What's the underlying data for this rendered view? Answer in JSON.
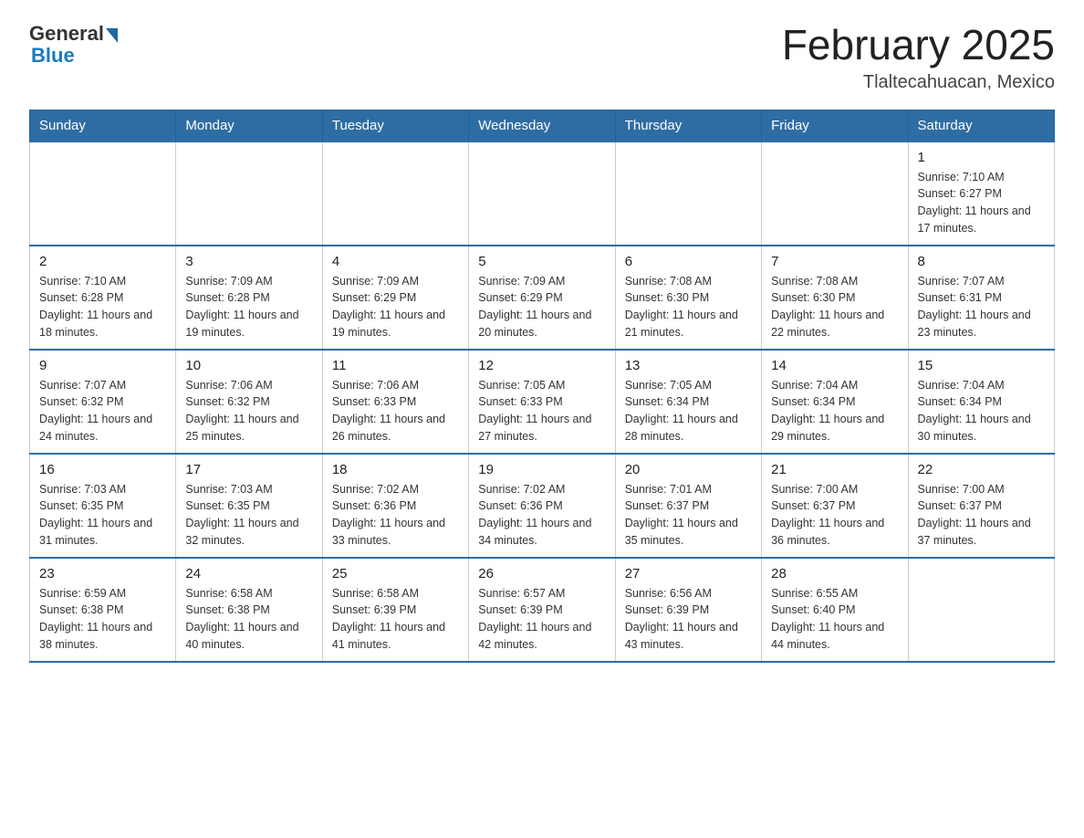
{
  "logo": {
    "general": "General",
    "blue": "Blue"
  },
  "header": {
    "title": "February 2025",
    "location": "Tlaltecahuacan, Mexico"
  },
  "weekdays": [
    "Sunday",
    "Monday",
    "Tuesday",
    "Wednesday",
    "Thursday",
    "Friday",
    "Saturday"
  ],
  "weeks": [
    [
      {
        "day": "",
        "info": ""
      },
      {
        "day": "",
        "info": ""
      },
      {
        "day": "",
        "info": ""
      },
      {
        "day": "",
        "info": ""
      },
      {
        "day": "",
        "info": ""
      },
      {
        "day": "",
        "info": ""
      },
      {
        "day": "1",
        "info": "Sunrise: 7:10 AM\nSunset: 6:27 PM\nDaylight: 11 hours and 17 minutes."
      }
    ],
    [
      {
        "day": "2",
        "info": "Sunrise: 7:10 AM\nSunset: 6:28 PM\nDaylight: 11 hours and 18 minutes."
      },
      {
        "day": "3",
        "info": "Sunrise: 7:09 AM\nSunset: 6:28 PM\nDaylight: 11 hours and 19 minutes."
      },
      {
        "day": "4",
        "info": "Sunrise: 7:09 AM\nSunset: 6:29 PM\nDaylight: 11 hours and 19 minutes."
      },
      {
        "day": "5",
        "info": "Sunrise: 7:09 AM\nSunset: 6:29 PM\nDaylight: 11 hours and 20 minutes."
      },
      {
        "day": "6",
        "info": "Sunrise: 7:08 AM\nSunset: 6:30 PM\nDaylight: 11 hours and 21 minutes."
      },
      {
        "day": "7",
        "info": "Sunrise: 7:08 AM\nSunset: 6:30 PM\nDaylight: 11 hours and 22 minutes."
      },
      {
        "day": "8",
        "info": "Sunrise: 7:07 AM\nSunset: 6:31 PM\nDaylight: 11 hours and 23 minutes."
      }
    ],
    [
      {
        "day": "9",
        "info": "Sunrise: 7:07 AM\nSunset: 6:32 PM\nDaylight: 11 hours and 24 minutes."
      },
      {
        "day": "10",
        "info": "Sunrise: 7:06 AM\nSunset: 6:32 PM\nDaylight: 11 hours and 25 minutes."
      },
      {
        "day": "11",
        "info": "Sunrise: 7:06 AM\nSunset: 6:33 PM\nDaylight: 11 hours and 26 minutes."
      },
      {
        "day": "12",
        "info": "Sunrise: 7:05 AM\nSunset: 6:33 PM\nDaylight: 11 hours and 27 minutes."
      },
      {
        "day": "13",
        "info": "Sunrise: 7:05 AM\nSunset: 6:34 PM\nDaylight: 11 hours and 28 minutes."
      },
      {
        "day": "14",
        "info": "Sunrise: 7:04 AM\nSunset: 6:34 PM\nDaylight: 11 hours and 29 minutes."
      },
      {
        "day": "15",
        "info": "Sunrise: 7:04 AM\nSunset: 6:34 PM\nDaylight: 11 hours and 30 minutes."
      }
    ],
    [
      {
        "day": "16",
        "info": "Sunrise: 7:03 AM\nSunset: 6:35 PM\nDaylight: 11 hours and 31 minutes."
      },
      {
        "day": "17",
        "info": "Sunrise: 7:03 AM\nSunset: 6:35 PM\nDaylight: 11 hours and 32 minutes."
      },
      {
        "day": "18",
        "info": "Sunrise: 7:02 AM\nSunset: 6:36 PM\nDaylight: 11 hours and 33 minutes."
      },
      {
        "day": "19",
        "info": "Sunrise: 7:02 AM\nSunset: 6:36 PM\nDaylight: 11 hours and 34 minutes."
      },
      {
        "day": "20",
        "info": "Sunrise: 7:01 AM\nSunset: 6:37 PM\nDaylight: 11 hours and 35 minutes."
      },
      {
        "day": "21",
        "info": "Sunrise: 7:00 AM\nSunset: 6:37 PM\nDaylight: 11 hours and 36 minutes."
      },
      {
        "day": "22",
        "info": "Sunrise: 7:00 AM\nSunset: 6:37 PM\nDaylight: 11 hours and 37 minutes."
      }
    ],
    [
      {
        "day": "23",
        "info": "Sunrise: 6:59 AM\nSunset: 6:38 PM\nDaylight: 11 hours and 38 minutes."
      },
      {
        "day": "24",
        "info": "Sunrise: 6:58 AM\nSunset: 6:38 PM\nDaylight: 11 hours and 40 minutes."
      },
      {
        "day": "25",
        "info": "Sunrise: 6:58 AM\nSunset: 6:39 PM\nDaylight: 11 hours and 41 minutes."
      },
      {
        "day": "26",
        "info": "Sunrise: 6:57 AM\nSunset: 6:39 PM\nDaylight: 11 hours and 42 minutes."
      },
      {
        "day": "27",
        "info": "Sunrise: 6:56 AM\nSunset: 6:39 PM\nDaylight: 11 hours and 43 minutes."
      },
      {
        "day": "28",
        "info": "Sunrise: 6:55 AM\nSunset: 6:40 PM\nDaylight: 11 hours and 44 minutes."
      },
      {
        "day": "",
        "info": ""
      }
    ]
  ]
}
